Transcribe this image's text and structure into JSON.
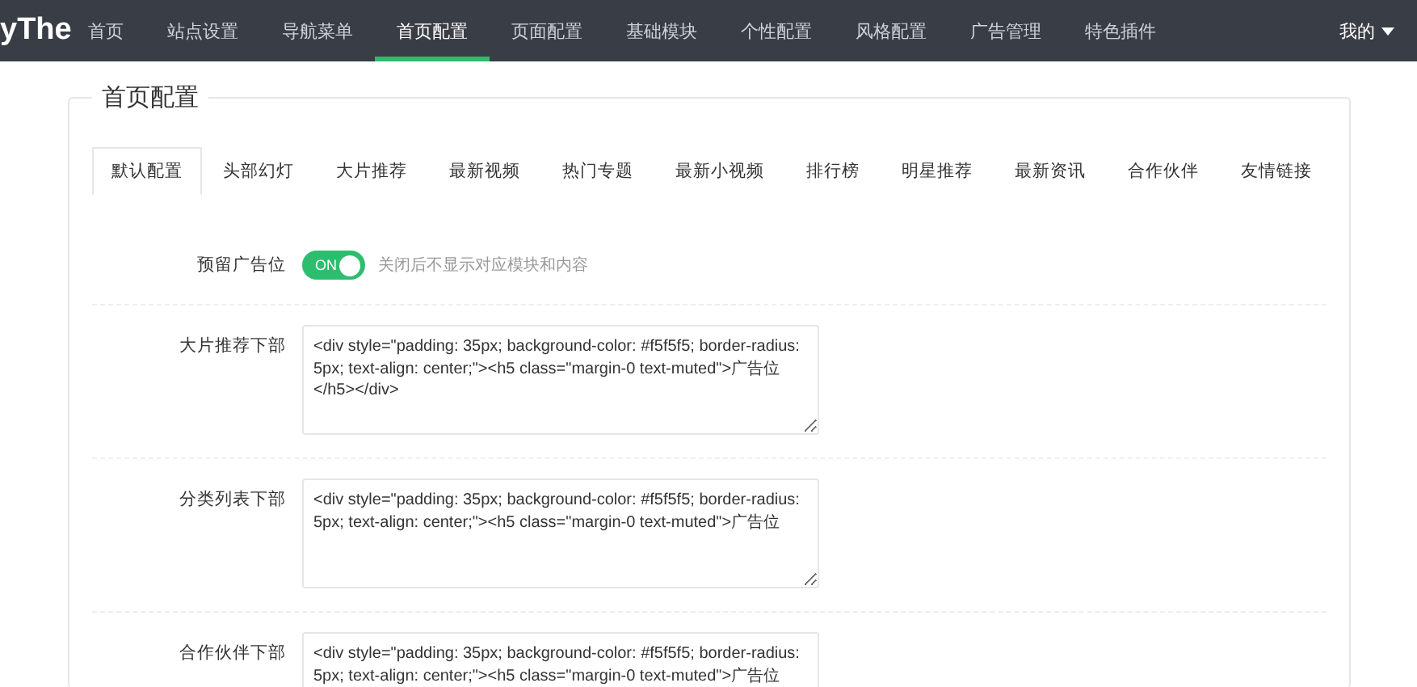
{
  "nav": {
    "logo": "yThe",
    "items": [
      {
        "label": "首页",
        "selected": false
      },
      {
        "label": "站点设置",
        "selected": false
      },
      {
        "label": "导航菜单",
        "selected": false
      },
      {
        "label": "首页配置",
        "selected": true
      },
      {
        "label": "页面配置",
        "selected": false
      },
      {
        "label": "基础模块",
        "selected": false
      },
      {
        "label": "个性配置",
        "selected": false
      },
      {
        "label": "风格配置",
        "selected": false
      },
      {
        "label": "广告管理",
        "selected": false
      },
      {
        "label": "特色插件",
        "selected": false
      }
    ],
    "user": "我的"
  },
  "panel": {
    "title": "首页配置",
    "tabs": [
      {
        "label": "默认配置",
        "selected": true
      },
      {
        "label": "头部幻灯",
        "selected": false
      },
      {
        "label": "大片推荐",
        "selected": false
      },
      {
        "label": "最新视频",
        "selected": false
      },
      {
        "label": "热门专题",
        "selected": false
      },
      {
        "label": "最新小视频",
        "selected": false
      },
      {
        "label": "排行榜",
        "selected": false
      },
      {
        "label": "明星推荐",
        "selected": false
      },
      {
        "label": "最新资讯",
        "selected": false
      },
      {
        "label": "合作伙伴",
        "selected": false
      },
      {
        "label": "友情链接",
        "selected": false
      }
    ],
    "fields": [
      {
        "kind": "switch",
        "label": "预留广告位",
        "on": true,
        "switch_text": "ON",
        "hint": "关闭后不显示对应模块和内容"
      },
      {
        "kind": "textarea",
        "label": "大片推荐下部",
        "value": "<div style=\"padding: 35px; background-color: #f5f5f5; border-radius: 5px; text-align: center;\"><h5 class=\"margin-0 text-muted\">广告位</h5></div>"
      },
      {
        "kind": "textarea",
        "label": "分类列表下部",
        "value": "<div style=\"padding: 35px; background-color: #f5f5f5; border-radius: 5px; text-align: center;\"><h5 class=\"margin-0 text-muted\">广告位"
      },
      {
        "kind": "textarea",
        "label": "合作伙伴下部",
        "value": "<div style=\"padding: 35px; background-color: #f5f5f5; border-radius: 5px; text-align: center;\"><h5 class=\"margin-0 text-muted\">广告位"
      }
    ]
  }
}
